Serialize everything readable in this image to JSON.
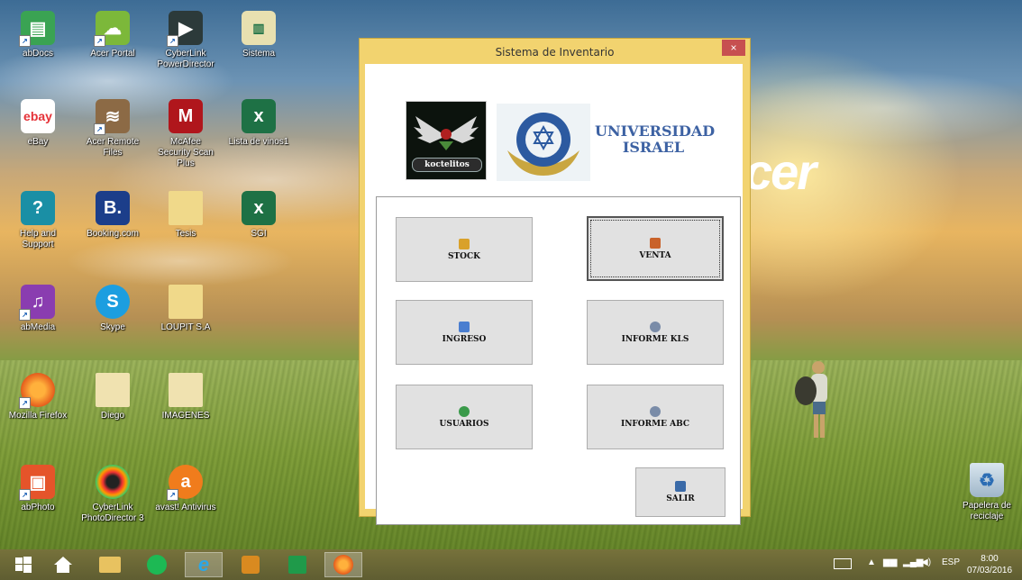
{
  "desktop": {
    "brand_text": "cer",
    "icons": [
      {
        "label": "abDocs"
      },
      {
        "label": "Acer Portal"
      },
      {
        "label": "CyberLink PowerDirector"
      },
      {
        "label": "Sistema"
      },
      {
        "label": "eBay",
        "glyph": "ebay"
      },
      {
        "label": "Acer Remote Files"
      },
      {
        "label": "McAfee Security Scan Plus",
        "glyph": "M"
      },
      {
        "label": "Lista de vinos1",
        "glyph": "x"
      },
      {
        "label": "Help and Support",
        "glyph": "?"
      },
      {
        "label": "Booking.com",
        "glyph": "B."
      },
      {
        "label": "Tesis"
      },
      {
        "label": "SGI",
        "glyph": "x"
      },
      {
        "label": "abMedia"
      },
      {
        "label": "Skype",
        "glyph": "S"
      },
      {
        "label": "LOUPIT S.A"
      },
      {
        "label": "Mozilla Firefox"
      },
      {
        "label": "Diego"
      },
      {
        "label": "IMAGENES"
      },
      {
        "label": "abPhoto"
      },
      {
        "label": "CyberLink PhotoDirector 3"
      },
      {
        "label": "avast! Antivirus"
      },
      {
        "label": "Papelera de reciclaje"
      }
    ]
  },
  "window": {
    "title": "Sistema de Inventario",
    "close_glyph": "×",
    "logos": {
      "koctelitos": "koctelitos",
      "university_line1": "UNIVERSIDAD",
      "university_line2": "ISRAEL"
    },
    "buttons": {
      "stock": "STOCK",
      "venta": "VENTA",
      "ingreso": "INGRESO",
      "informe_kls": "INFORME KLS",
      "usuarios": "USUARIOS",
      "informe_abc": "INFORME ABC",
      "salir": "SALIR"
    }
  },
  "taskbar": {
    "language": "ESP",
    "time": "8:00",
    "date": "07/03/2016"
  },
  "colors": {
    "window_frame": "#f2d36f",
    "close_button": "#c75050",
    "button_face": "#e1e1e1",
    "university_blue": "#3d62a3"
  }
}
